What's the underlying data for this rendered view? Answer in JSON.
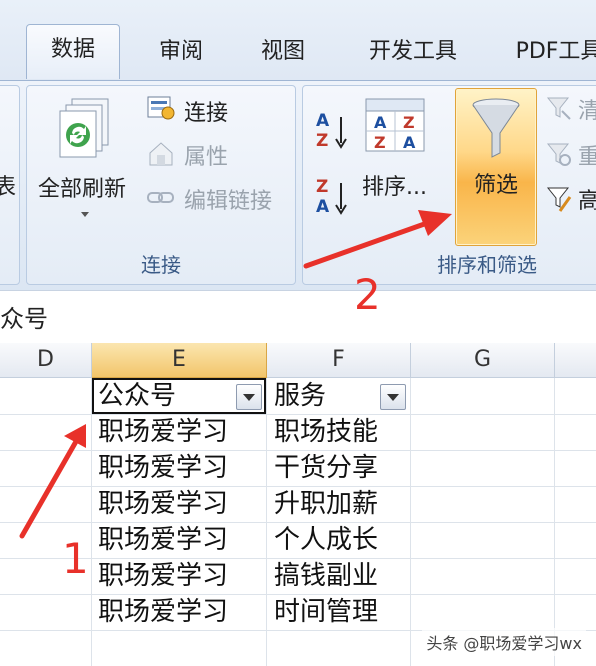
{
  "tabs": [
    {
      "label": "数据",
      "active": true
    },
    {
      "label": "审阅"
    },
    {
      "label": "视图"
    },
    {
      "label": "开发工具"
    },
    {
      "label": "PDF工具"
    }
  ],
  "ribbon": {
    "left_fragment": "表",
    "connections_group": {
      "label": "连接",
      "refresh_all": "全部刷新",
      "connections": "连接",
      "properties": "属性",
      "edit_links": "编辑链接"
    },
    "sort_filter_group": {
      "label": "排序和筛选",
      "sort": "排序...",
      "filter": "筛选",
      "sort_az_top": "A",
      "sort_az_bottom": "Z",
      "sort_za_top": "Z",
      "sort_za_bottom": "A",
      "clear_fragment": "清",
      "reapply_fragment": "重",
      "advanced_fragment": "高"
    }
  },
  "formula_bar": {
    "content_fragment": "众号"
  },
  "columns": [
    {
      "label": "D"
    },
    {
      "label": "E",
      "selected": true
    },
    {
      "label": "F"
    },
    {
      "label": "G"
    }
  ],
  "table": {
    "headers": [
      "公众号",
      "服务"
    ],
    "rows": [
      [
        "职场爱学习",
        "职场技能"
      ],
      [
        "职场爱学习",
        "干货分享"
      ],
      [
        "职场爱学习",
        "升职加薪"
      ],
      [
        "职场爱学习",
        "个人成长"
      ],
      [
        "职场爱学习",
        "搞钱副业"
      ],
      [
        "职场爱学习",
        "时间管理"
      ]
    ]
  },
  "annotations": {
    "step1": "1",
    "step2": "2",
    "arrow_color": "#e8312a"
  },
  "watermark": "头条 @职场爱学习wx"
}
